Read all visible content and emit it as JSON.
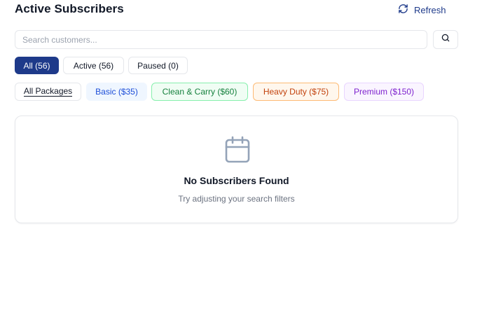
{
  "header": {
    "title": "Active Subscribers",
    "refresh_label": "Refresh"
  },
  "search": {
    "placeholder": "Search customers..."
  },
  "status_tabs": [
    {
      "label": "All (56)",
      "active": true
    },
    {
      "label": "Active (56)",
      "active": false
    },
    {
      "label": "Paused (0)",
      "active": false
    }
  ],
  "package_filters": [
    {
      "label": "All Packages"
    },
    {
      "label": "Basic ($35)",
      "color": "#1d4ed8"
    },
    {
      "label": "Clean & Carry ($60)",
      "color": "#15803d"
    },
    {
      "label": "Heavy Duty ($75)",
      "color": "#c2410c"
    },
    {
      "label": "Premium ($150)",
      "color": "#7e22ce"
    }
  ],
  "empty_state": {
    "icon": "calendar-icon",
    "title": "No Subscribers Found",
    "subtitle": "Try adjusting your search filters"
  },
  "colors": {
    "accent": "#1e3a8a"
  }
}
